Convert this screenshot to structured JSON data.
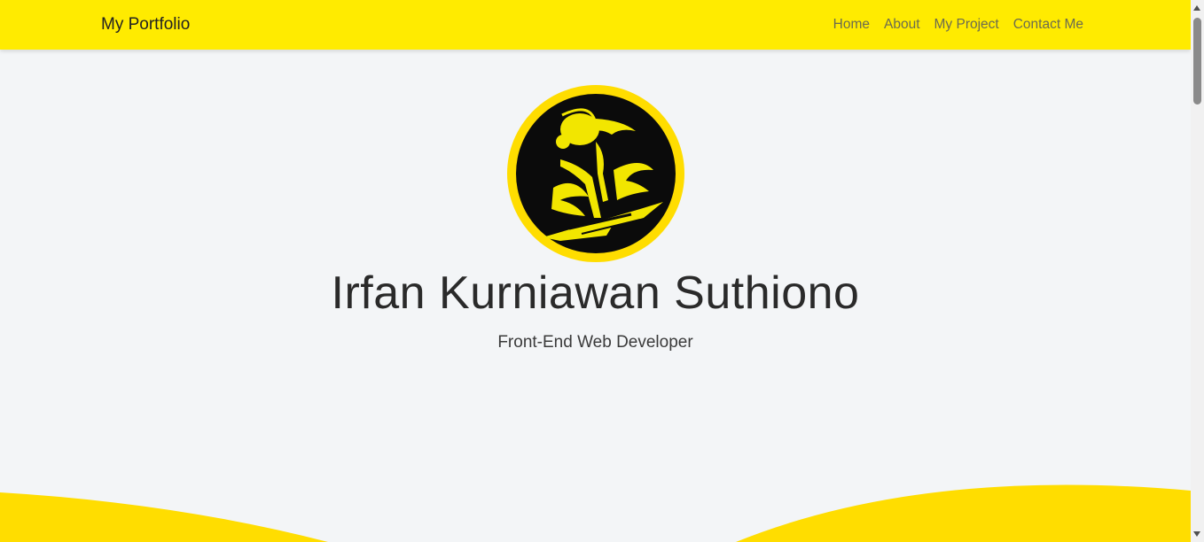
{
  "navbar": {
    "brand": "My Portfolio",
    "links": [
      "Home",
      "About",
      "My Project",
      "Contact Me"
    ]
  },
  "hero": {
    "avatar_icon": "stylized-figure-logo-icon",
    "name": "Irfan Kurniawan Suthiono",
    "role": "Front-End Web Developer"
  },
  "colors": {
    "navbar_bg": "#ffeb00",
    "accent": "#ffdd00",
    "page_bg": "#f3f5f7"
  }
}
